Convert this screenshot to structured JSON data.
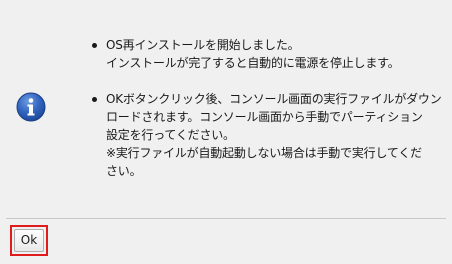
{
  "dialog": {
    "icon": "info-icon",
    "accent_color": "#2b5fb4",
    "messages": [
      {
        "lines": [
          "OS再インストールを開始しました。",
          "インストールが完了すると自動的に電源を停止します。"
        ]
      },
      {
        "lines": [
          "OKボタンクリック後、コンソール画面の実行ファイルがダウン",
          "ロードされます。コンソール画面から手動でパーティション",
          "設定を行ってください。",
          "※実行ファイルが自動起動しない場合は手動で実行してくだ",
          "さい。"
        ]
      }
    ],
    "ok_label": "Ok",
    "highlight_color": "#e01b1b"
  }
}
